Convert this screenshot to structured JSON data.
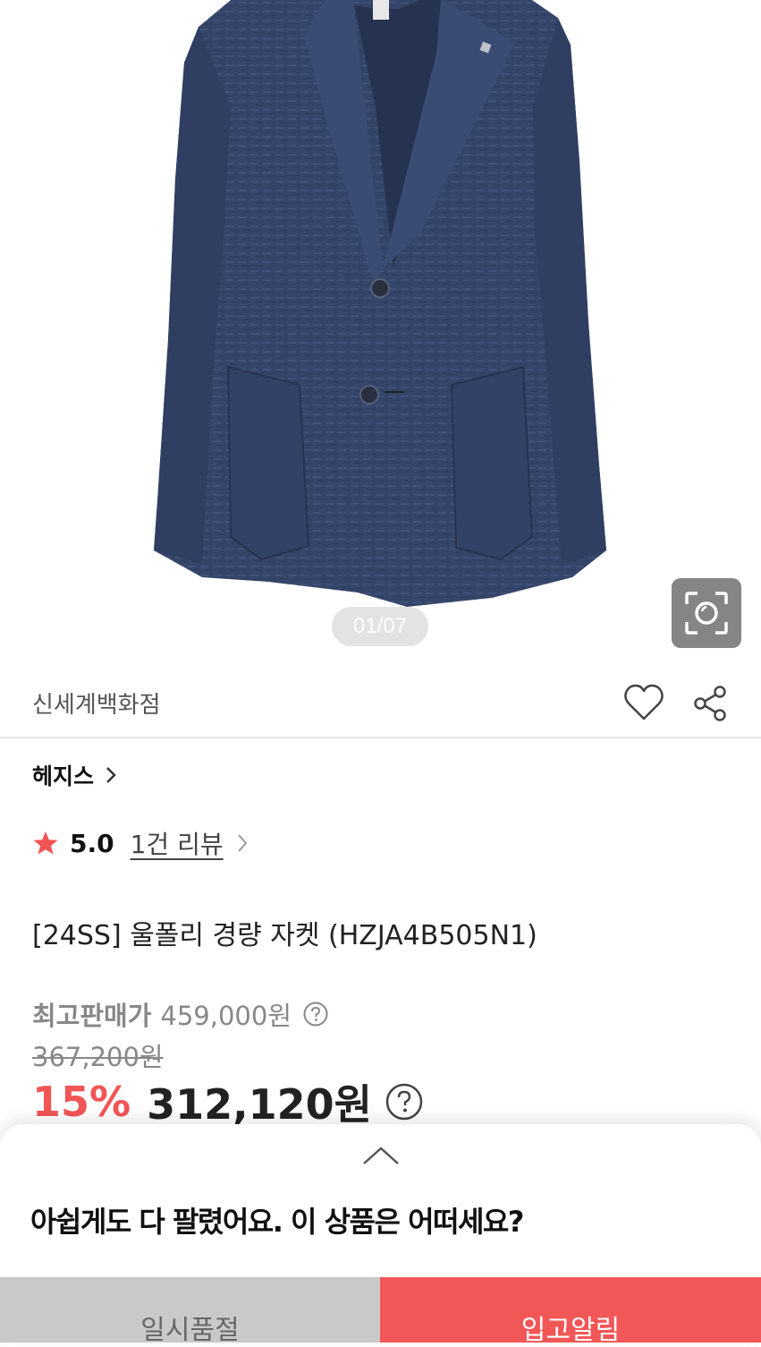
{
  "gallery": {
    "counter": "01/07",
    "lens_icon": "camera-lens-icon",
    "image_subject": "navy-blazer"
  },
  "seller": {
    "name": "신세계백화점",
    "like_icon": "heart-icon",
    "share_icon": "share-icon"
  },
  "brand": {
    "name": "헤지스",
    "chevron": "chevron-right-icon"
  },
  "rating": {
    "score": "5.0",
    "review_link": "1건 리뷰",
    "star_color": "#f25555"
  },
  "product": {
    "title": "[24SS] 울폴리 경량 자켓 (HZJA4B505N1)"
  },
  "price": {
    "max_label": "최고판매가",
    "max_value": "459,000원",
    "original": "367,200원",
    "discount": "15%",
    "final": "312,120원"
  },
  "sheet": {
    "message": "아쉽게도 다 팔렸어요. 이 상품은 어떠세요?",
    "soldout_button": "일시품절",
    "notify_button": "입고알림"
  },
  "colors": {
    "accent": "#f25757",
    "soldout_bg": "#c9c9c9"
  }
}
